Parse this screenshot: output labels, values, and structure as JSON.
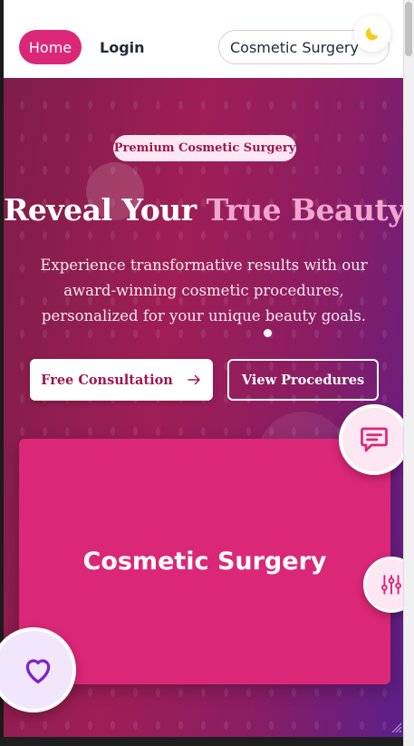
{
  "header": {
    "nav": [
      {
        "label": "Home",
        "active": true
      },
      {
        "label": "Login",
        "active": false
      }
    ],
    "search": {
      "value": "Cosmetic Surgery"
    },
    "theme_icon": "moon-icon"
  },
  "hero": {
    "badge": "Premium Cosmetic Surgery",
    "title_main": "Reveal Your ",
    "title_accent": "True Beauty",
    "subtitle": "Experience transformative results with our award-winning cosmetic procedures, personalized for your unique beauty goals.",
    "primary_button": "Free Consultation",
    "secondary_button": "View Procedures",
    "card_title": "Cosmetic Surgery"
  },
  "floating": {
    "chat_icon": "chat-icon",
    "filter_icon": "sliders-icon",
    "favorite_icon": "heart-icon"
  },
  "colors": {
    "brand_pink": "#db2777",
    "accent_light": "#fce7f3",
    "title_accent": "#f0a6cf",
    "purple": "#7e22ce"
  }
}
